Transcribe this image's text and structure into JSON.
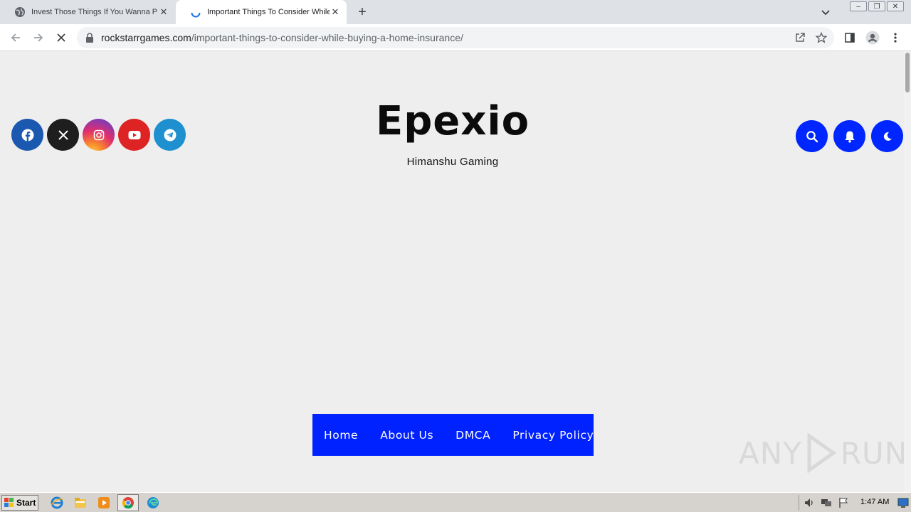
{
  "browser": {
    "tabs": [
      {
        "title": "Invest Those Things If You Wanna P",
        "active": false
      },
      {
        "title": "Important Things To Consider While B",
        "active": true
      }
    ],
    "url_host": "rockstarrgames.com",
    "url_path": "/important-things-to-consider-while-buying-a-home-insurance/"
  },
  "site": {
    "brand": "Epexio",
    "tagline": "Himanshu Gaming",
    "socials": [
      {
        "icon": "facebook-icon",
        "color": "#1b58b0"
      },
      {
        "icon": "x-icon",
        "color": "#1e1e1e"
      },
      {
        "icon": "instagram-icon",
        "color": "#e1306c"
      },
      {
        "icon": "youtube-icon",
        "color": "#dd2323"
      },
      {
        "icon": "telegram-icon",
        "color": "#1e90d0"
      }
    ],
    "actions": [
      "search-icon",
      "bell-icon",
      "moon-icon"
    ],
    "menu": [
      "Home",
      "About Us",
      "DMCA",
      "Privacy Policy"
    ],
    "accent": "#0022ff"
  },
  "watermark": {
    "left": "ANY",
    "right": "RUN"
  },
  "taskbar": {
    "start_label": "Start",
    "clock": "1:47 AM"
  }
}
